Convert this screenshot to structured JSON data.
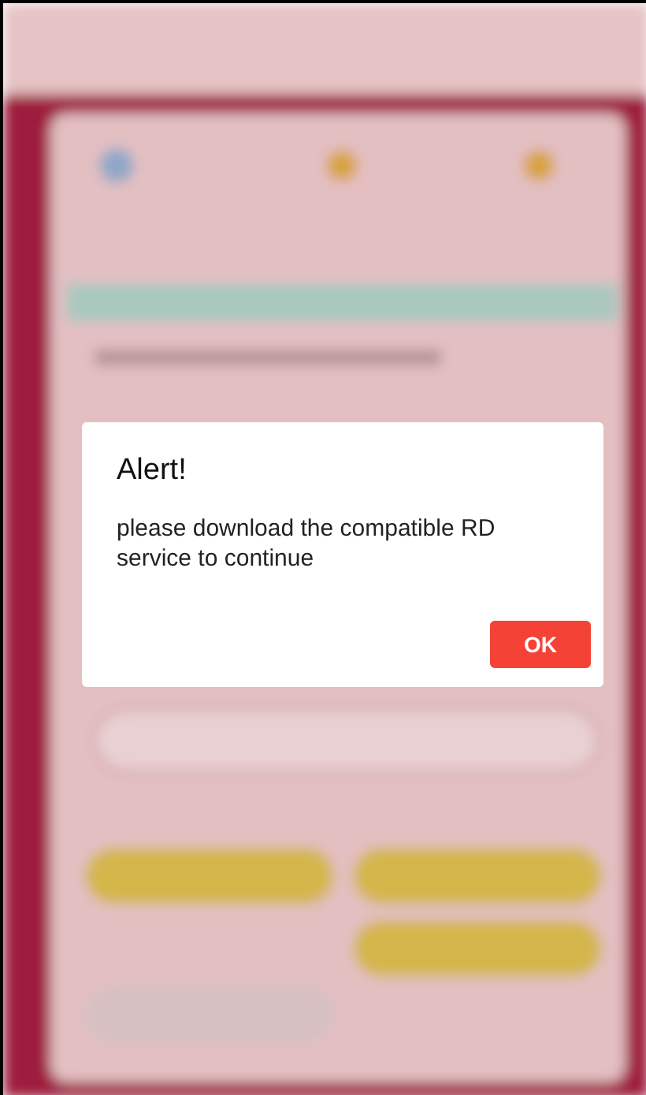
{
  "dialog": {
    "title": "Alert!",
    "message": "please download the compatible RD service to continue",
    "button": "OK"
  }
}
